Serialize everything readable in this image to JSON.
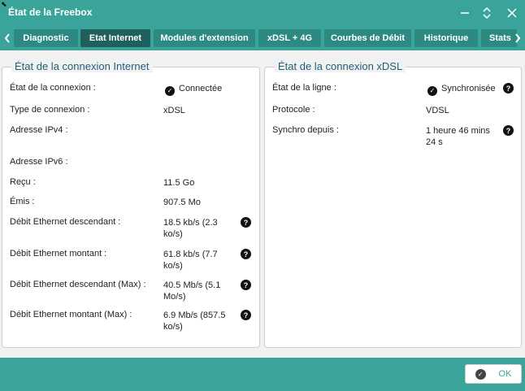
{
  "window": {
    "title": "État de la Freebox"
  },
  "tabs": [
    {
      "label": "Diagnostic"
    },
    {
      "label": "Etat Internet"
    },
    {
      "label": "Modules d'extension"
    },
    {
      "label": "xDSL + 4G"
    },
    {
      "label": "Courbes de Débit"
    },
    {
      "label": "Historique"
    },
    {
      "label": "Stats"
    }
  ],
  "internet": {
    "title": "État de la connexion Internet",
    "rows": [
      {
        "label": "État de la connexion :",
        "value": "Connectée"
      },
      {
        "label": "Type de connexion :",
        "value": "xDSL"
      },
      {
        "label": "Adresse IPv4 :",
        "value": ""
      },
      {
        "label": "Adresse IPv6 :",
        "value": ""
      },
      {
        "label": "Reçu :",
        "value": "11.5 Go"
      },
      {
        "label": "Émis :",
        "value": "907.5 Mo"
      },
      {
        "label": "Débit Ethernet descendant :",
        "value": "18.5 kb/s (2.3 ko/s)"
      },
      {
        "label": "Débit Ethernet montant :",
        "value": "61.8 kb/s (7.7 ko/s)"
      },
      {
        "label": "Débit Ethernet descendant (Max) :",
        "value": "40.5 Mb/s (5.1 Mo/s)"
      },
      {
        "label": "Débit Ethernet montant (Max) :",
        "value": "6.9 Mb/s (857.5 ko/s)"
      }
    ]
  },
  "xdsl": {
    "title": "État de la connexion xDSL",
    "rows": [
      {
        "label": "État de la ligne :",
        "value": "Synchronisée"
      },
      {
        "label": "Protocole :",
        "value": "VDSL"
      },
      {
        "label": "Synchro depuis :",
        "value": "1 heure 46 mins 24 s"
      }
    ]
  },
  "footer": {
    "ok_label": "OK"
  },
  "icons": {
    "help": "question-circle-icon",
    "check": "check-circle-icon",
    "minimize": "minimize-icon",
    "maximize": "maximize-icon",
    "close": "close-icon"
  },
  "colors": {
    "accent": "#3aa39a",
    "active_tab": "#1f5f5c",
    "panel_title": "#1f5f7a"
  }
}
